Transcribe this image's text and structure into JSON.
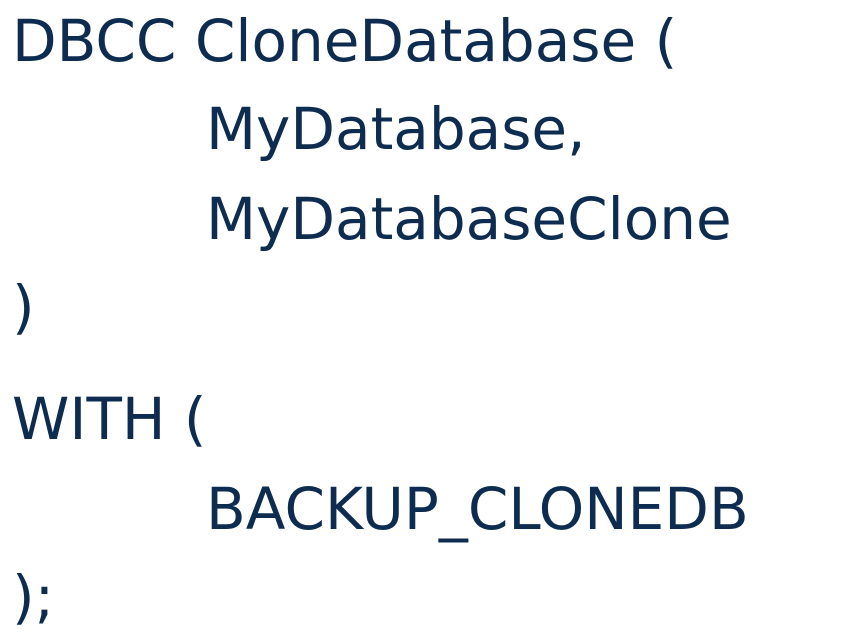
{
  "code": {
    "lines": [
      "DBCC CloneDatabase (",
      "MyDatabase,",
      "MyDatabaseClone",
      ")",
      "WITH (",
      "BACKUP_CLONEDB",
      ");"
    ]
  },
  "colors": {
    "text": "#0d2c4f",
    "background": "#ffffff"
  }
}
